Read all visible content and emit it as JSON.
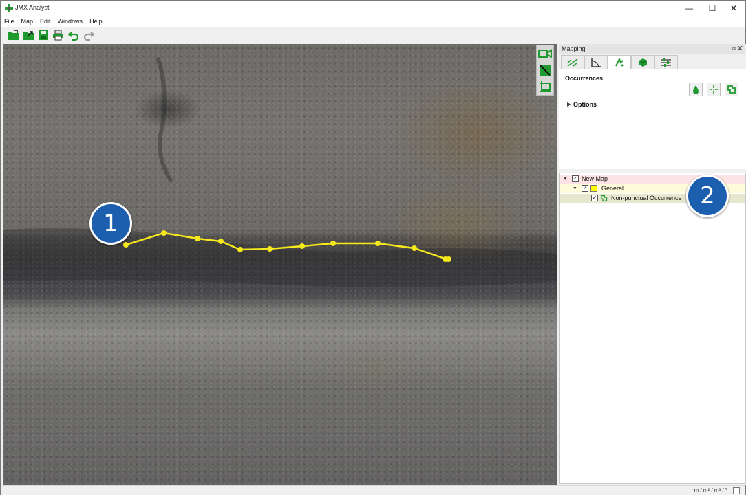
{
  "window": {
    "title": "JMX Analyst",
    "controls": {
      "minimize": "—",
      "maximize": "☐",
      "close": "✕"
    }
  },
  "menu": [
    "File",
    "Map",
    "Edit",
    "Windows",
    "Help"
  ],
  "toolbar": {
    "buttons": [
      "new-map-icon",
      "open-icon",
      "save-icon",
      "print-icon",
      "undo-icon",
      "redo-icon"
    ]
  },
  "map": {
    "callouts": {
      "one": "1",
      "two": "2"
    },
    "polyline_color": "#f5e81c",
    "side_tools": [
      "camera-view-icon",
      "draw-line-icon",
      "draw-polygon-icon"
    ]
  },
  "panel": {
    "title": "Mapping",
    "float_glyph": "⧉",
    "close_glyph": "✕",
    "tabs": [
      "measure-icon",
      "angle-icon",
      "occurrence-icon",
      "surface-icon",
      "settings-icon"
    ],
    "occurrences_label": "Occurrences",
    "occurrence_buttons": [
      "point-occurrence-icon",
      "crosshair-occurrence-icon",
      "non-punctual-occurrence-icon"
    ],
    "options_label": "Options"
  },
  "tree": {
    "items": [
      {
        "label": "New Map",
        "checked": true,
        "expand": "▼",
        "highlight": "#fde3e3"
      },
      {
        "label": "General",
        "checked": true,
        "expand": "▼",
        "highlight": "#fdfbd9",
        "swatch": "#ffff00"
      },
      {
        "label": "Non-punctual Occurrence",
        "checked": true,
        "highlight": "#e7e7cf"
      }
    ]
  },
  "status": {
    "units": "m / m² / m³ / °"
  },
  "colors": {
    "accent_green": "#1f9a2e",
    "callout_blue": "#1b5fae"
  }
}
